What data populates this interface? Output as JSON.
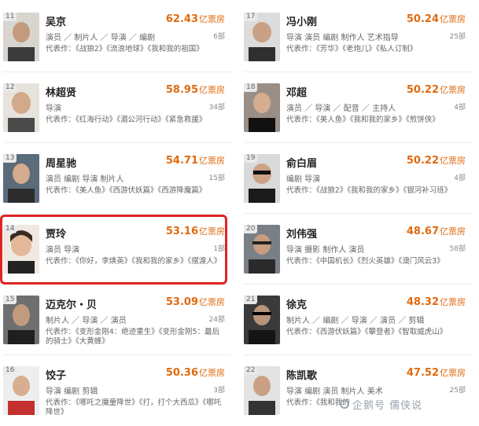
{
  "unit_label": "亿票房",
  "accent_color": "#e06a10",
  "highlight_color": "#e02424",
  "watermark": "企鹅号 儒侠说",
  "left": [
    {
      "rank": "11",
      "name": "吴京",
      "amount": "62.43",
      "roles": "演员 ／ 制片人 ／ 导演 ／ 编剧",
      "count": "6部",
      "works": "代表作：《战狼2》《流浪地球》《我和我的祖国》"
    },
    {
      "rank": "12",
      "name": "林超贤",
      "amount": "58.95",
      "roles": "导演",
      "count": "34部",
      "works": "代表作：《红海行动》《湄公河行动》《紧急救援》"
    },
    {
      "rank": "13",
      "name": "周星驰",
      "amount": "54.71",
      "roles": "演员 编剧 导演 制片人",
      "count": "15部",
      "works": "代表作：《美人鱼》《西游伏妖篇》《西游降魔篇》"
    },
    {
      "rank": "14",
      "name": "贾玲",
      "amount": "53.16",
      "roles": "演员 导演",
      "count": "1部",
      "works": "代表作：《你好，李焕英》《我和我的家乡》《摆渡人》"
    },
    {
      "rank": "15",
      "name": "迈克尔・贝",
      "amount": "53.09",
      "roles": "制片人 ／ 导演 ／ 演员",
      "count": "24部",
      "works": "代表作：《变形金刚4：绝迹重生》《变形金刚5：最后的骑士》《大黄蜂》"
    },
    {
      "rank": "16",
      "name": "饺子",
      "amount": "50.36",
      "roles": "导演 编剧 剪辑",
      "count": "3部",
      "works": "代表作：《哪吒之魔童降世》《打，打个大西瓜》《哪吒降世》"
    }
  ],
  "right": [
    {
      "rank": "17",
      "name": "冯小刚",
      "amount": "50.24",
      "roles": "导演 演员 编剧 制作人 艺术指导",
      "count": "25部",
      "works": "代表作：《芳华》《老炮儿》《私人订制》"
    },
    {
      "rank": "18",
      "name": "邓超",
      "amount": "50.22",
      "roles": "演员 ／ 导演 ／ 配音 ／ 主持人",
      "count": "4部",
      "works": "代表作：《美人鱼》《我和我的家乡》《煎饼侠》"
    },
    {
      "rank": "19",
      "name": "俞白眉",
      "amount": "50.22",
      "roles": "编剧 导演",
      "count": "4部",
      "works": "代表作：《战狼2》《我和我的家乡》《银河补习班》"
    },
    {
      "rank": "20",
      "name": "刘伟强",
      "amount": "48.67",
      "roles": "导演 摄影 制作人 演员",
      "count": "58部",
      "works": "代表作：《中国机长》《烈火英雄》《澳门风云3》"
    },
    {
      "rank": "21",
      "name": "徐克",
      "amount": "48.32",
      "roles": "制片人 ／ 编剧 ／ 导演 ／ 演员 ／ 剪辑",
      "count": "",
      "works": "代表作：《西游伏妖篇》《攀登者》《智取威虎山》"
    },
    {
      "rank": "22",
      "name": "陈凯歌",
      "amount": "47.52",
      "roles": "导演 编剧 演员 制片人 美术",
      "count": "25部",
      "works": "代表作：《我和我的"
    }
  ]
}
